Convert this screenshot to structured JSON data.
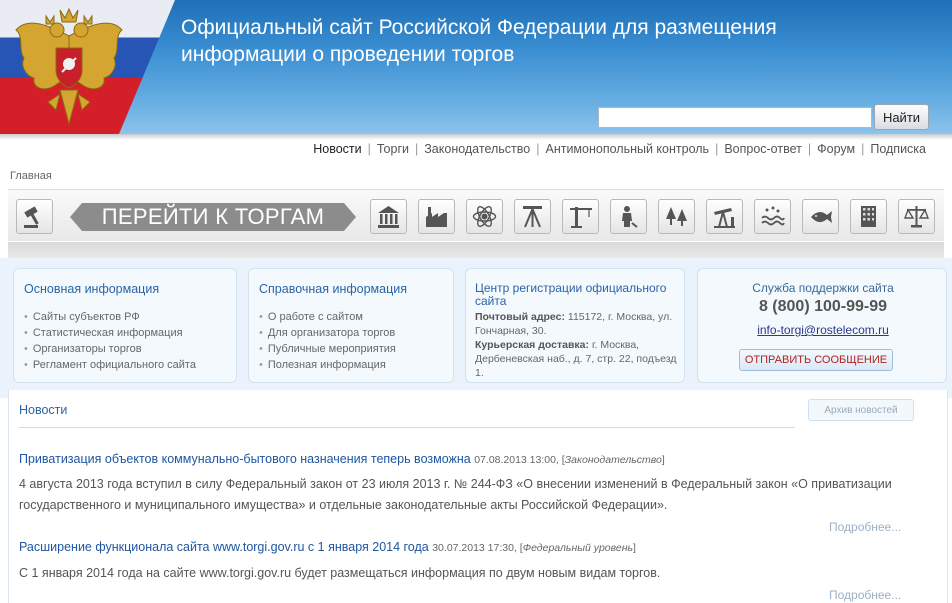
{
  "header": {
    "title_line1": "Официальный сайт Российской Федерации для размещения",
    "title_line2": "информации о проведении торгов",
    "search_placeholder": "",
    "search_button": "Найти"
  },
  "nav": {
    "items": [
      "Новости",
      "Торги",
      "Законодательство",
      "Антимонопольный контроль",
      "Вопрос-ответ",
      "Форум",
      "Подписка"
    ]
  },
  "breadcrumb": "Главная",
  "catbar": {
    "goto_label": "ПЕРЕЙТИ К ТОРГАМ",
    "icons": [
      "gavel-icon",
      "government-building-icon",
      "factory-icon",
      "atom-copyright-icon",
      "drilling-rig-icon",
      "crane-icon",
      "person-icon",
      "forest-icon",
      "oil-pump-icon",
      "water-icon",
      "fish-icon",
      "office-building-icon",
      "scales-icon"
    ]
  },
  "blocks": {
    "main": {
      "title": "Основная информация",
      "items": [
        "Сайты субъектов РФ",
        "Статистическая информация",
        "Организаторы торгов",
        "Регламент официального сайта"
      ]
    },
    "reference": {
      "title": "Справочная информация",
      "items": [
        "О работе с сайтом",
        "Для организатора торгов",
        "Публичные мероприятия",
        "Полезная информация"
      ]
    },
    "registration": {
      "title": "Центр регистрации официального сайта",
      "postal_label": "Почтовый адрес:",
      "postal_value": "115172, г. Москва, ул. Гончарная, 30.",
      "courier_label": "Курьерская доставка:",
      "courier_value": "г. Москва, Дербеневская наб., д. 7, стр. 22, подъезд 1."
    },
    "support": {
      "title": "Служба поддержки сайта",
      "phone": "8 (800) 100-99-99",
      "email": "info-torgi@rostelecom.ru",
      "send_button": "ОТПРАВИТЬ СООБЩЕНИЕ"
    }
  },
  "news": {
    "section_title": "Новости",
    "archive_button": "Архив новостей",
    "items": [
      {
        "title": "Приватизация объектов коммунально-бытового назначения теперь возможна",
        "date": "07.08.2013 13:00,",
        "category": "Законодательство",
        "body": "4 августа 2013 года вступил в силу Федеральный закон от 23 июля 2013 г. № 244-ФЗ «О внесении изменений в Федеральный закон «О приватизации государственного и муниципального имущества» и отдельные законодательные акты Российской Федерации».",
        "more": "Подробнее..."
      },
      {
        "title": "Расширение функционала сайта www.torgi.gov.ru с 1 января 2014 года",
        "date": "30.07.2013 17:30,",
        "category": "Федеральный уровень",
        "body": "С 1 января 2014 года на сайте www.torgi.gov.ru будет размещаться информация по двум новым видам торгов.",
        "more": "Подробнее..."
      }
    ]
  }
}
